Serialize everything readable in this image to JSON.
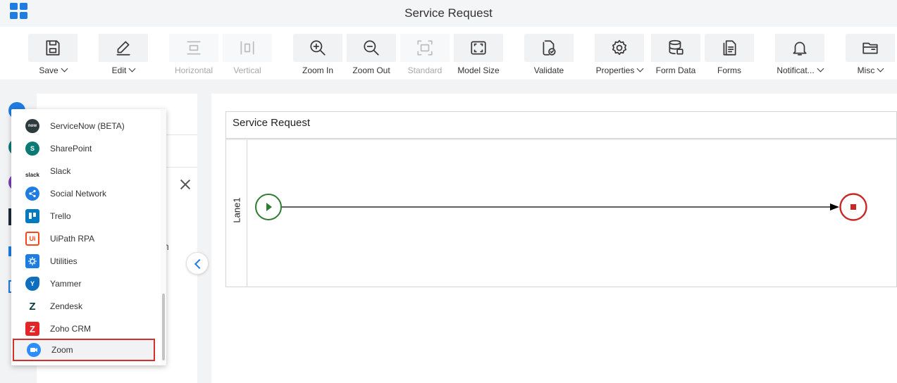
{
  "header": {
    "title": "Service Request"
  },
  "toolbar": {
    "buttons": [
      {
        "label": "Save",
        "icon": "save-icon",
        "enabled": true,
        "dropdown": true
      },
      {
        "label": "Edit",
        "icon": "edit-icon",
        "enabled": true,
        "dropdown": true
      },
      {
        "label": "Horizontal",
        "icon": "horizontal-icon",
        "enabled": false,
        "dropdown": false
      },
      {
        "label": "Vertical",
        "icon": "vertical-icon",
        "enabled": false,
        "dropdown": false
      },
      {
        "label": "Zoom In",
        "icon": "zoom-in-icon",
        "enabled": true,
        "dropdown": false
      },
      {
        "label": "Zoom Out",
        "icon": "zoom-out-icon",
        "enabled": true,
        "dropdown": false
      },
      {
        "label": "Standard",
        "icon": "standard-icon",
        "enabled": false,
        "dropdown": false
      },
      {
        "label": "Model Size",
        "icon": "model-size-icon",
        "enabled": true,
        "dropdown": false
      },
      {
        "label": "Validate",
        "icon": "validate-icon",
        "enabled": true,
        "dropdown": false
      },
      {
        "label": "Properties",
        "icon": "gear-icon",
        "enabled": true,
        "dropdown": true
      },
      {
        "label": "Form Data",
        "icon": "database-icon",
        "enabled": true,
        "dropdown": false
      },
      {
        "label": "Forms",
        "icon": "forms-icon",
        "enabled": true,
        "dropdown": false
      },
      {
        "label": "Notificat...",
        "icon": "bell-icon",
        "enabled": true,
        "dropdown": true
      },
      {
        "label": "Misc",
        "icon": "folder-icon",
        "enabled": true,
        "dropdown": true
      }
    ]
  },
  "side_panel": {
    "peek_text": "h"
  },
  "dropdown": {
    "items": [
      {
        "label": "ServiceNow (BETA)",
        "icon": "servicenow-icon",
        "badge": "now",
        "color": "#2e3b3d"
      },
      {
        "label": "SharePoint",
        "icon": "sharepoint-icon",
        "badge": "S",
        "color": "#0b7a75"
      },
      {
        "label": "Slack",
        "icon": "slack-icon",
        "badge": "slack",
        "color": "#4a154b"
      },
      {
        "label": "Social Network",
        "icon": "share-icon",
        "badge": "",
        "color": "#1f7ce0"
      },
      {
        "label": "Trello",
        "icon": "trello-icon",
        "badge": "",
        "color": "#0079bf"
      },
      {
        "label": "UiPath RPA",
        "icon": "uipath-icon",
        "badge": "Ui",
        "color": "#fa4616"
      },
      {
        "label": "Utilities",
        "icon": "utilities-icon",
        "badge": "",
        "color": "#1f7ce0"
      },
      {
        "label": "Yammer",
        "icon": "yammer-icon",
        "badge": "Y",
        "color": "#106ebe"
      },
      {
        "label": "Zendesk",
        "icon": "zendesk-icon",
        "badge": "Z",
        "color": "#03363d"
      },
      {
        "label": "Zoho CRM",
        "icon": "zoho-icon",
        "badge": "Z",
        "color": "#e42527"
      },
      {
        "label": "Zoom",
        "icon": "zoom-video-icon",
        "badge": "",
        "color": "#2d8cff",
        "selected": true
      }
    ]
  },
  "canvas": {
    "pool_title": "Service Request",
    "lane_label": "Lane1"
  },
  "colors": {
    "accent": "#1f7ce0",
    "start_event": "#2e7d32",
    "end_event": "#c62828",
    "selection_outline": "#d32f2f"
  }
}
